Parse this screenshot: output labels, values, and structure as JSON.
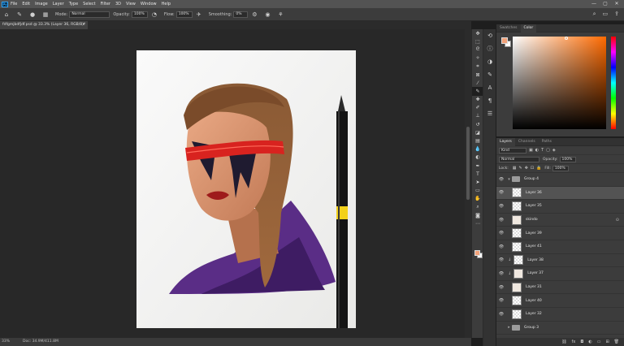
{
  "menu": [
    "File",
    "Edit",
    "Image",
    "Layer",
    "Type",
    "Select",
    "Filter",
    "3D",
    "View",
    "Window",
    "Help"
  ],
  "app_logo": "Ps",
  "window_controls": [
    "—",
    "▢",
    "✕"
  ],
  "options": {
    "mode_label": "Mode:",
    "mode_value": "Normal",
    "opacity_label": "Opacity:",
    "opacity_value": "100%",
    "flow_label": "Flow:",
    "flow_value": "100%",
    "smoothing_label": "Smoothing:",
    "smoothing_value": "0%"
  },
  "document_tab": {
    "title": "fdfgmjbdfjdf.psd @ 33.3% (Layer 36, RGB/8)",
    "modified": "*",
    "close": "×"
  },
  "status": {
    "zoom": "33%",
    "doc_info": "Doc: 34.9M/411.8M"
  },
  "color_panel": {
    "tabs": [
      "Swatches",
      "Color"
    ],
    "active_tab": "Color",
    "foreground": "#f2a27a",
    "background": "#ffffff"
  },
  "layers_panel": {
    "tabs": [
      "Layers",
      "Channels",
      "Paths"
    ],
    "active_tab": "Layers",
    "kind_filter": "Kind",
    "blend_mode": "Normal",
    "opacity_label": "Opacity:",
    "opacity_value": "100%",
    "lock_label": "Lock:",
    "fill_label": "Fill:",
    "fill_value": "100%",
    "layers": [
      {
        "name": "Group 4",
        "type": "group",
        "expanded": true,
        "visible": true
      },
      {
        "name": "Layer 36",
        "type": "layer",
        "selected": true,
        "visible": true
      },
      {
        "name": "Layer 35",
        "type": "layer",
        "visible": true
      },
      {
        "name": "skindo",
        "type": "art",
        "visible": true,
        "fx": true
      },
      {
        "name": "Layer 39",
        "type": "layer",
        "visible": true
      },
      {
        "name": "Layer 41",
        "type": "layer",
        "visible": true
      },
      {
        "name": "Layer 38",
        "type": "layer",
        "visible": true,
        "clipped": true
      },
      {
        "name": "Layer 37",
        "type": "art",
        "visible": true,
        "clipped": true
      },
      {
        "name": "Layer 31",
        "type": "art",
        "visible": true
      },
      {
        "name": "Layer 40",
        "type": "layer",
        "visible": true
      },
      {
        "name": "Layer 32",
        "type": "layer",
        "visible": true
      },
      {
        "name": "Group 3",
        "type": "group",
        "expanded": false,
        "visible": false
      },
      {
        "name": "Group 2",
        "type": "group",
        "expanded": false,
        "visible": false
      }
    ]
  }
}
